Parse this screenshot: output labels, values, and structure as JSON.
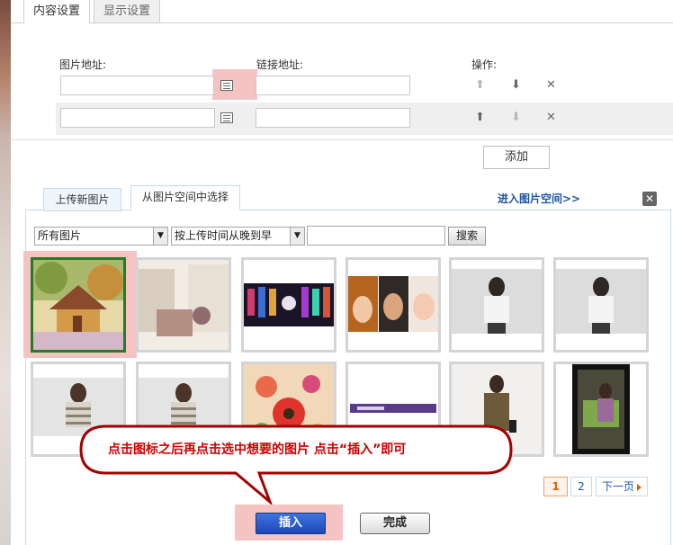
{
  "tabs": {
    "content": "内容设置",
    "display": "显示设置"
  },
  "form": {
    "image_url_label": "图片地址:",
    "link_url_label": "链接地址:",
    "actions_label": "操作:",
    "add_label": "添加",
    "row1": {
      "image_url": "",
      "link_url": ""
    },
    "row2": {
      "image_url": "",
      "link_url": ""
    }
  },
  "dialog": {
    "tab_upload": "上传新图片",
    "tab_space": "从图片空间中选择",
    "enter_space_link": "进入图片空间>>",
    "close": "✕",
    "filter_category": "所有图片",
    "filter_sort": "按上传时间从晚到早",
    "search_value": "",
    "search_button": "搜索"
  },
  "thumbs": [
    {
      "name": "house-photo",
      "selected": true
    },
    {
      "name": "curtain-photo",
      "selected": false
    },
    {
      "name": "banner-photo",
      "selected": false
    },
    {
      "name": "faces-photo",
      "selected": false
    },
    {
      "name": "woman-white-photo-1",
      "selected": false
    },
    {
      "name": "woman-white-photo-2",
      "selected": false
    },
    {
      "name": "girl-stripes-photo-1",
      "selected": false
    },
    {
      "name": "girl-stripes-photo-2",
      "selected": false
    },
    {
      "name": "flowers-photo",
      "selected": false
    },
    {
      "name": "banner-text-photo",
      "selected": false
    },
    {
      "name": "woman-coat-photo",
      "selected": false
    },
    {
      "name": "woman-sitting-photo",
      "selected": false
    }
  ],
  "callout": {
    "text": "点击图标之后再点击选中想要的图片 点击“插入”即可"
  },
  "pagination": {
    "page1": "1",
    "page2": "2",
    "next": "下一页"
  },
  "buttons": {
    "insert": "插入",
    "done": "完成"
  },
  "colors": {
    "accent_link": "#1f55a4",
    "selected_border": "#267b24",
    "highlight": "#f6c3c3",
    "callout_text": "#cc0000"
  }
}
